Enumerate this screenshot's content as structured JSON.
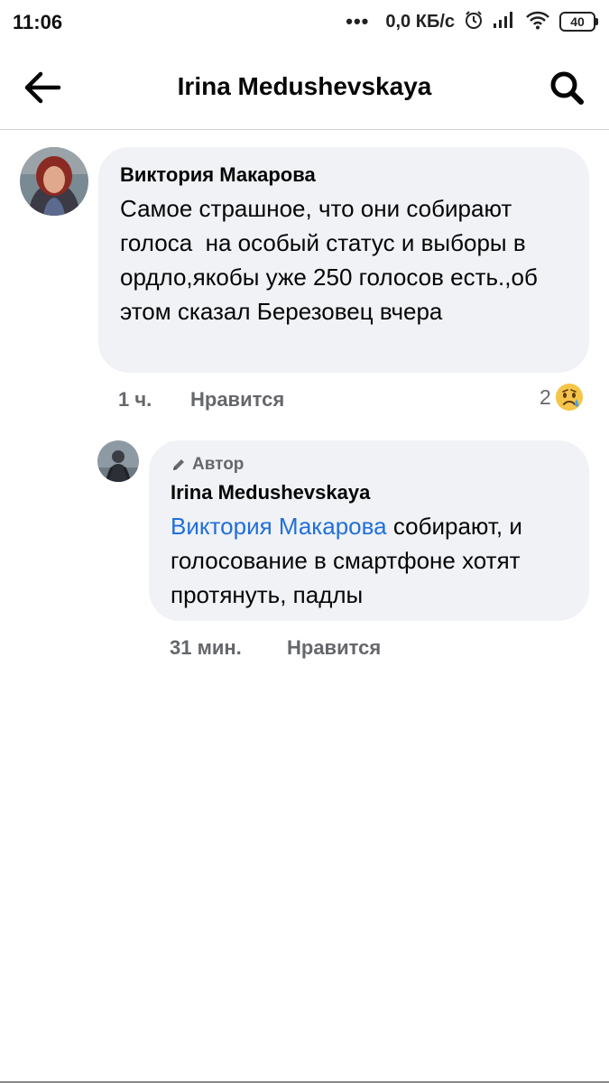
{
  "status_bar": {
    "time": "11:06",
    "dots": "•••",
    "network_speed": "0,0 КБ/с",
    "battery_level": "40",
    "icons": [
      "alarm-icon",
      "signal-icon",
      "wifi-icon",
      "battery-icon"
    ]
  },
  "header": {
    "title": "Irina Medushevskaya",
    "back_icon": "arrow-left-icon",
    "search_icon": "search-icon"
  },
  "comment": {
    "author": "Виктория Макарова",
    "text": "Самое страшное, что они собирают голоса  на особый статус и выборы в ордло,якобы уже 250 голосов есть.,об этом сказал Березовец вчера",
    "time": "1 ч.",
    "like_label": "Нравится",
    "reaction_count": "2",
    "reaction_icon": "sad-emoji-icon"
  },
  "reply": {
    "badge_label": "Автор",
    "badge_icon": "pencil-icon",
    "author": "Irina Medushevskaya",
    "mention": "Виктория Макарова",
    "text": " собирают, и голосование в смартфоне хотят протянуть, падлы",
    "time": "31 мин.",
    "like_label": "Нравится"
  },
  "colors": {
    "bubble_bg": "#f0f2f5",
    "mention": "#216fdb",
    "secondary_text": "#65676b"
  }
}
